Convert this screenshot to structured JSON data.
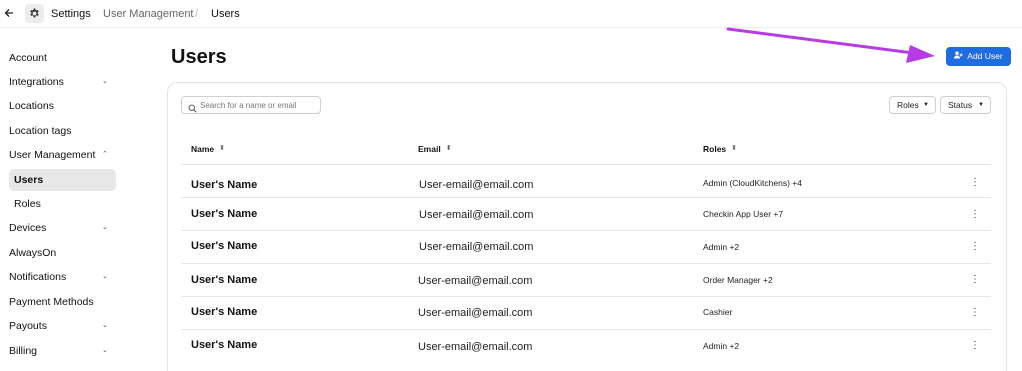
{
  "breadcrumb": {
    "settings": "Settings",
    "section": "User Management",
    "separator": "/",
    "current": "Users"
  },
  "sidebar": {
    "items": [
      {
        "label": "Account"
      },
      {
        "label": "Integrations",
        "chevron": "⌄"
      },
      {
        "label": "Locations"
      },
      {
        "label": "Location tags"
      },
      {
        "label": "User Management",
        "chevron": "⌃"
      },
      {
        "label": "Users"
      },
      {
        "label": "Roles"
      },
      {
        "label": "Devices",
        "chevron": "⌄"
      },
      {
        "label": "AlwaysOn"
      },
      {
        "label": "Notifications",
        "chevron": "⌄"
      },
      {
        "label": "Payment Methods"
      },
      {
        "label": "Payouts",
        "chevron": "⌄"
      },
      {
        "label": "Billing",
        "chevron": "⌄"
      }
    ]
  },
  "page": {
    "title": "Users",
    "add_user_label": "Add User"
  },
  "search": {
    "placeholder": "Search for a name or email",
    "value": ""
  },
  "filters": {
    "roles": "Roles",
    "status": "Status"
  },
  "table": {
    "headers": {
      "name": "Name",
      "email": "Email",
      "roles": "Roles"
    },
    "rows": [
      {
        "name": "User's Name",
        "email": "User-email@email.com",
        "roles": "Admin (CloudKitchens) +4"
      },
      {
        "name": "User's Name",
        "email": "User-email@email.com",
        "roles": "Checkin App User +7"
      },
      {
        "name": "User's Name",
        "email": "User-email@email.com",
        "roles": "Admin +2"
      },
      {
        "name": "User's Name",
        "email": "User-email@email.com",
        "roles": "Order Manager +2"
      },
      {
        "name": "User's Name",
        "email": "User-email@email.com",
        "roles": "Cashier"
      },
      {
        "name": "User's Name",
        "email": "User-email@email.com",
        "roles": "Admin +2"
      }
    ]
  },
  "colors": {
    "accent": "#1f6be0",
    "annotation_arrow": "#b53be6",
    "active_nav_bg": "#e8e8e8"
  },
  "icons": {
    "back": "back-arrow-icon",
    "settings": "gear-icon",
    "search": "search-icon",
    "add_user": "user-plus-icon",
    "row_menu": "more-vertical-icon",
    "sort": "sort-icon"
  }
}
